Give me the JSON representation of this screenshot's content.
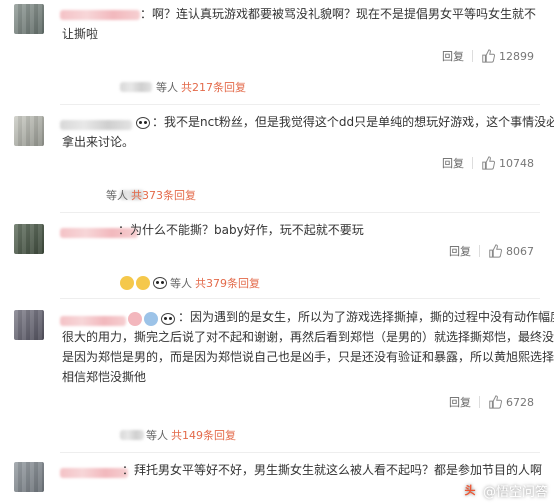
{
  "comments": [
    {
      "text_lines": [
        "：啊？连认真玩游戏都要被骂没礼貌啊？现在不是提倡男女平等吗女生就不",
        "让撕啦"
      ],
      "reply_label": "回复",
      "likes": "12899",
      "sub_replies": {
        "prefix": "等人",
        "count": "共217条回复"
      }
    },
    {
      "text_lines": [
        "：我不是nct粉丝，但是我觉得这个dd只是单纯的想玩好游戏，这个事情没必要",
        "拿出来讨论。"
      ],
      "reply_label": "回复",
      "likes": "10748",
      "sub_replies": {
        "prefix": "等人",
        "count": "共373条回复"
      }
    },
    {
      "text_lines": [
        "：为什么不能撕？baby好作，玩不起就不要玩"
      ],
      "reply_label": "回复",
      "likes": "8067",
      "sub_replies": {
        "prefix": "等人",
        "count": "共379条回复"
      }
    },
    {
      "text_lines": [
        "：因为遇到的是女生，所以为了游戏选择撕掉，撕的过程中没有动作幅度",
        "很大的用力，撕完之后说了对不起和谢谢，再然后看到郑恺（是男的）就选择撕郑恺，最终没撕不",
        "是因为郑恺是男的，而是因为郑恺说自己也是凶手，只是还没有验证和暴露，所以黄旭熙选择暂时",
        "相信郑恺没撕他"
      ],
      "reply_label": "回复",
      "likes": "6728",
      "sub_replies": {
        "prefix": "等人",
        "count": "共149条回复"
      }
    },
    {
      "text_lines": [
        "：拜托男女平等好不好，男生撕女生就这么被人看不起吗？都是参加节目的人啊"
      ]
    }
  ],
  "watermark": {
    "logo": "头",
    "text": "@悟空问答"
  },
  "colors": {
    "accent": "#e36a4a",
    "text": "#333333",
    "muted": "#777777"
  }
}
